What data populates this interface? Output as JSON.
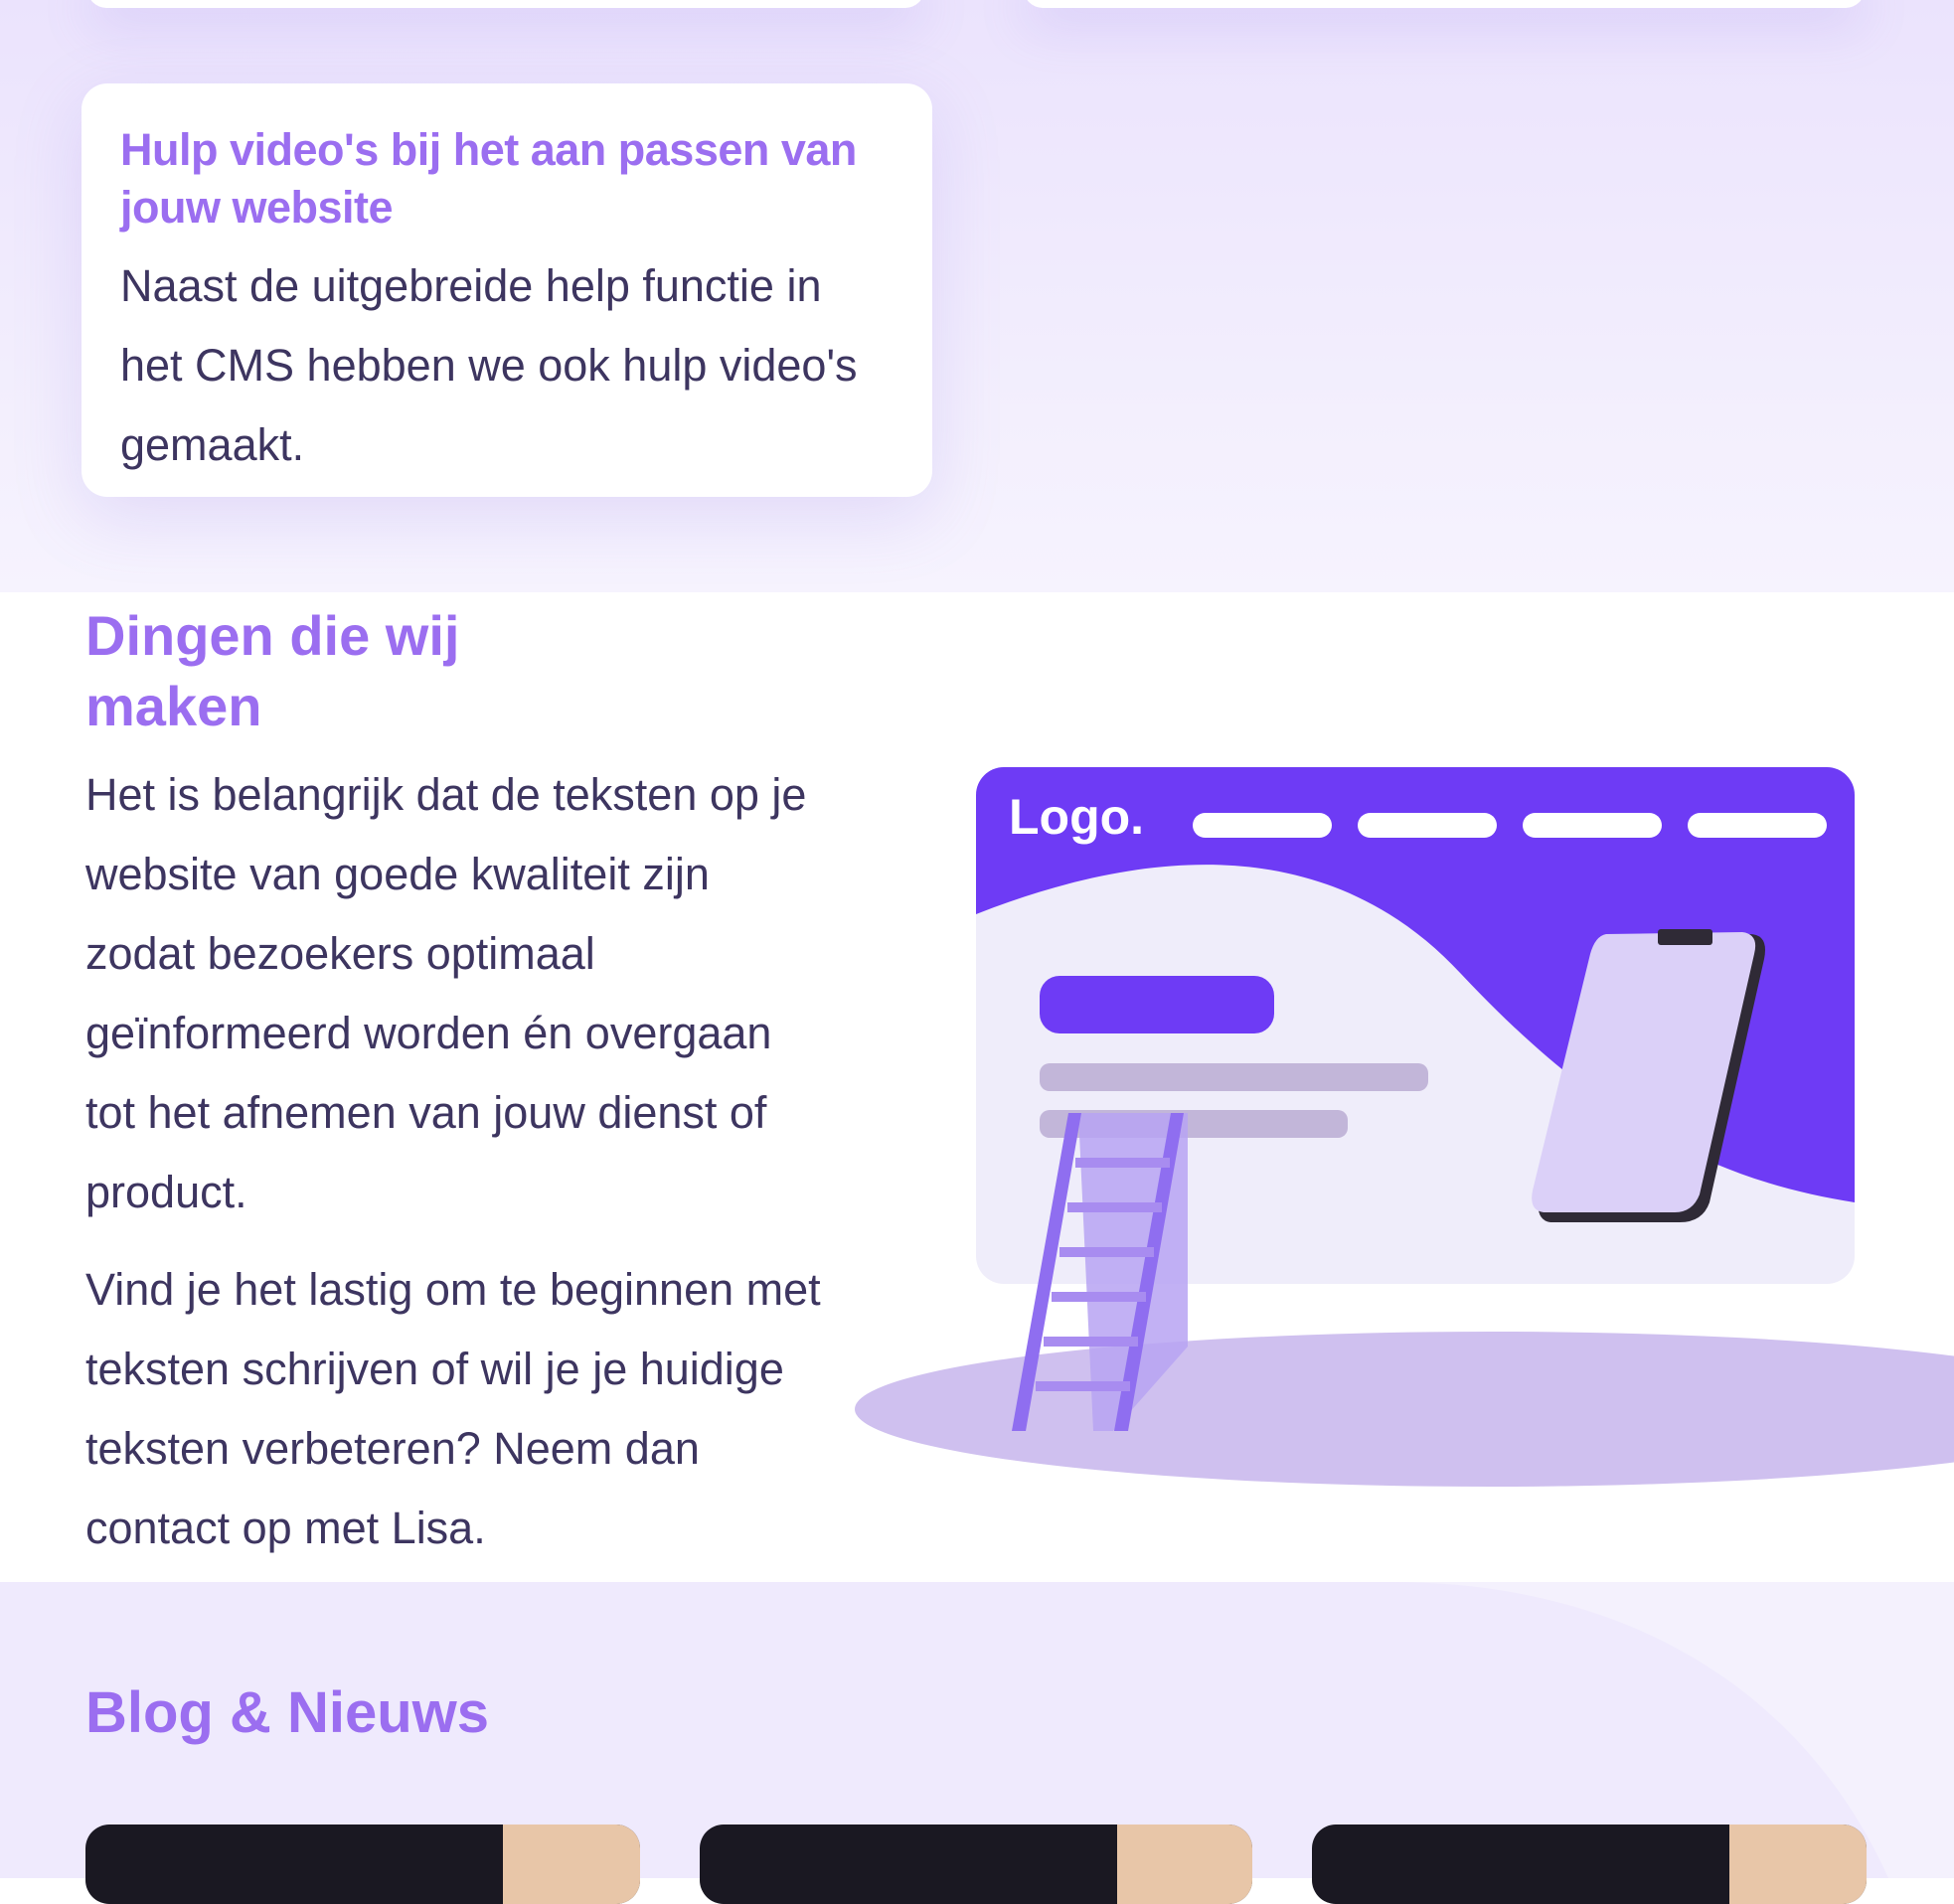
{
  "feature_card": {
    "title": "Hulp video's bij het aan passen van jouw website",
    "text": "Naast de uitgebreide help functie in het CMS hebben we ook hulp video's gemaakt."
  },
  "makes": {
    "title": "Dingen die wij maken",
    "paragraph_1": "Het is belangrijk dat de teksten op je website van goede kwaliteit zijn zodat bezoekers optimaal geïnformeerd worden én overgaan tot het afnemen van jouw dienst of product.",
    "paragraph_2": "Vind je het lastig om te beginnen met teksten schrijven of wil je je huidige teksten verbeteren? Neem dan contact op met Lisa."
  },
  "illustration": {
    "logo_text": "Logo.",
    "colors": {
      "primary": "#6e3bf5",
      "light": "#efedfa",
      "phone": "#dbd0f8",
      "ladder": "#a88cf0",
      "floor": "#cfc0ef"
    }
  },
  "blog": {
    "title": "Blog & Nieuws"
  },
  "colors": {
    "heading": "#9b6ef0",
    "body_text": "#3d3560",
    "band": "#ebe3fd"
  }
}
